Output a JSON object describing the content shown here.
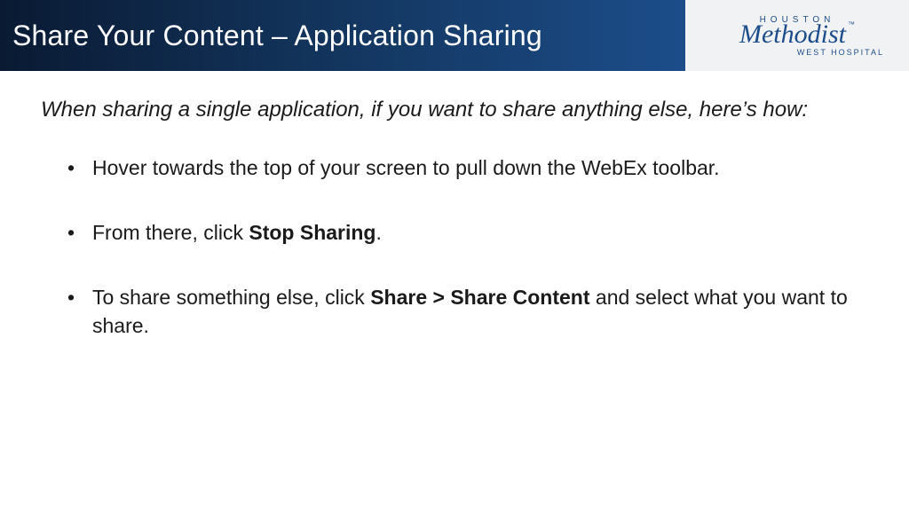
{
  "header": {
    "title": "Share Your Content – Application Sharing"
  },
  "logo": {
    "top": "HOUSTON",
    "main": "Methodist",
    "tm": "™",
    "sub": "WEST HOSPITAL"
  },
  "content": {
    "intro": "When sharing a single application, if you want to share anything else, here’s how:",
    "bullets": [
      {
        "segments": [
          {
            "text": "Hover towards the top of your screen to pull down the WebEx toolbar.",
            "bold": false
          }
        ]
      },
      {
        "segments": [
          {
            "text": "From there, click ",
            "bold": false
          },
          {
            "text": "Stop Sharing",
            "bold": true
          },
          {
            "text": ".",
            "bold": false
          }
        ]
      },
      {
        "segments": [
          {
            "text": "To share something else, click ",
            "bold": false
          },
          {
            "text": "Share > Share Content",
            "bold": true
          },
          {
            "text": " and select what you want to share.",
            "bold": false
          }
        ]
      }
    ]
  }
}
